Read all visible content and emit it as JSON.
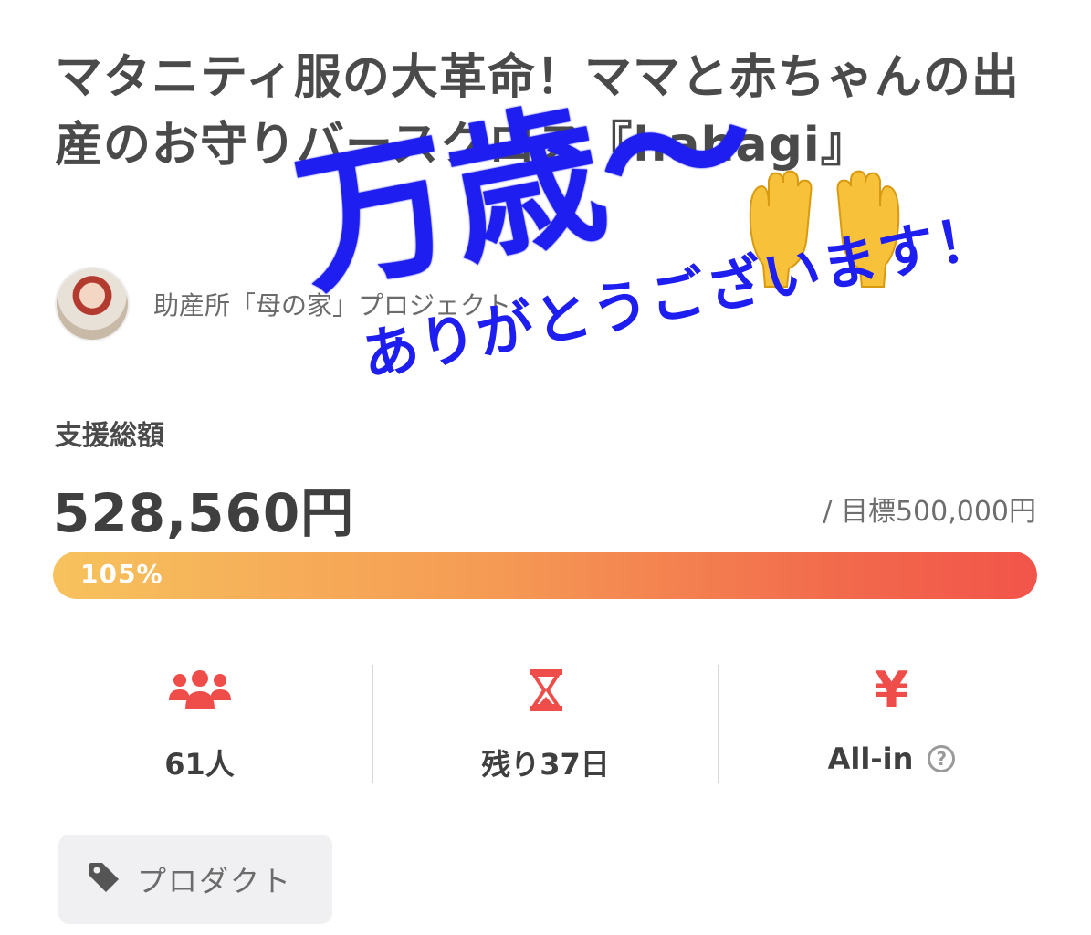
{
  "project": {
    "title": "マタニティ服の大革命！ママと赤ちゃんの出産のお守りバースクロス『hahagi』",
    "owner_name": "助産所「母の家」プロジェクト"
  },
  "funding": {
    "total_label": "支援総額",
    "amount": "528,560円",
    "goal": "/ 目標500,000円",
    "progress_percent_text": "105%",
    "progress_fraction": 1.0
  },
  "stats": [
    {
      "icon": "supporters-icon",
      "value": "61人"
    },
    {
      "icon": "hourglass-icon",
      "value": "残り37日"
    },
    {
      "icon": "yen-icon",
      "symbol": "¥",
      "value": "All-in"
    }
  ],
  "help_icon": "?",
  "tag": {
    "icon": "tag-icon",
    "label": "プロダクト"
  },
  "overlay": {
    "banzai": "万歳〜",
    "thanks": "ありがとうございます！"
  },
  "colors": {
    "accent_red": "#ef4d4a",
    "overlay_blue": "#1e1ef0",
    "progress_start": "#f7c25d",
    "progress_end": "#f2544a"
  }
}
